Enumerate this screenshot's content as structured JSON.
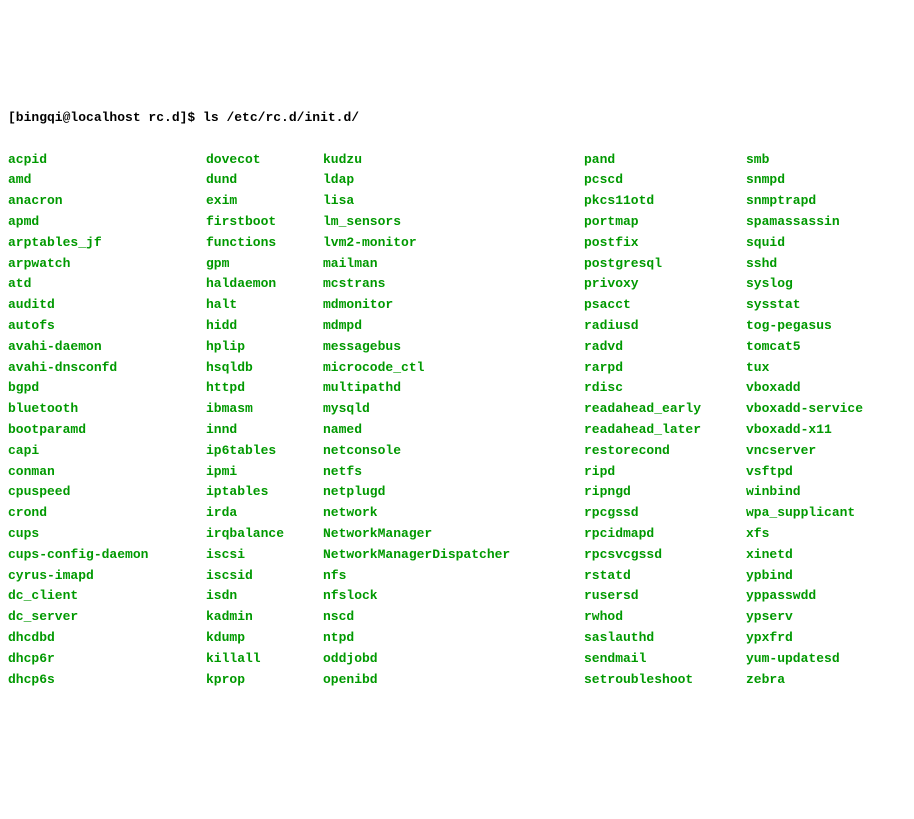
{
  "prompt": {
    "user_host": "[bingqi@localhost rc.d]$",
    "command": "ls /etc/rc.d/init.d/"
  },
  "columns": [
    [
      "acpid",
      "amd",
      "anacron",
      "apmd",
      "arptables_jf",
      "arpwatch",
      "atd",
      "auditd",
      "autofs",
      "avahi-daemon",
      "avahi-dnsconfd",
      "bgpd",
      "bluetooth",
      "bootparamd",
      "capi",
      "conman",
      "cpuspeed",
      "crond",
      "cups",
      "cups-config-daemon",
      "cyrus-imapd",
      "dc_client",
      "dc_server",
      "dhcdbd",
      "dhcp6r",
      "dhcp6s"
    ],
    [
      "dovecot",
      "dund",
      "exim",
      "firstboot",
      "functions",
      "gpm",
      "haldaemon",
      "halt",
      "hidd",
      "hplip",
      "hsqldb",
      "httpd",
      "ibmasm",
      "innd",
      "ip6tables",
      "ipmi",
      "iptables",
      "irda",
      "irqbalance",
      "iscsi",
      "iscsid",
      "isdn",
      "kadmin",
      "kdump",
      "killall",
      "kprop"
    ],
    [
      "kudzu",
      "ldap",
      "lisa",
      "lm_sensors",
      "lvm2-monitor",
      "mailman",
      "mcstrans",
      "mdmonitor",
      "mdmpd",
      "messagebus",
      "microcode_ctl",
      "multipathd",
      "mysqld",
      "named",
      "netconsole",
      "netfs",
      "netplugd",
      "network",
      "NetworkManager",
      "NetworkManagerDispatcher",
      "nfs",
      "nfslock",
      "nscd",
      "ntpd",
      "oddjobd",
      "openibd"
    ],
    [
      "pand",
      "pcscd",
      "pkcs11otd",
      "portmap",
      "postfix",
      "postgresql",
      "privoxy",
      "psacct",
      "radiusd",
      "radvd",
      "rarpd",
      "rdisc",
      "readahead_early",
      "readahead_later",
      "restorecond",
      "ripd",
      "ripngd",
      "rpcgssd",
      "rpcidmapd",
      "rpcsvcgssd",
      "rstatd",
      "rusersd",
      "rwhod",
      "saslauthd",
      "sendmail",
      "setroubleshoot"
    ],
    [
      "smb",
      "snmpd",
      "snmptrapd",
      "spamassassin",
      "squid",
      "sshd",
      "syslog",
      "sysstat",
      "tog-pegasus",
      "tomcat5",
      "tux",
      "vboxadd",
      "vboxadd-service",
      "vboxadd-x11",
      "vncserver",
      "vsftpd",
      "winbind",
      "wpa_supplicant",
      "xfs",
      "xinetd",
      "ypbind",
      "yppasswdd",
      "ypserv",
      "ypxfrd",
      "yum-updatesd",
      "zebra"
    ]
  ]
}
